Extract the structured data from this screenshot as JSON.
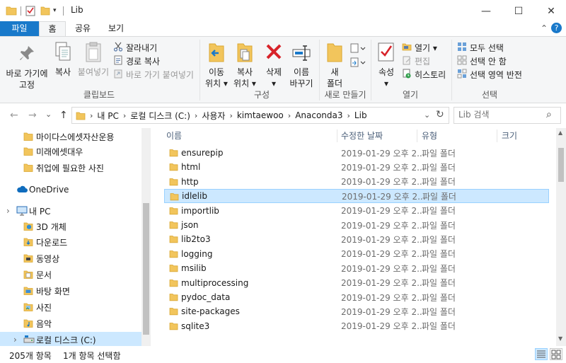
{
  "window": {
    "title": "Lib",
    "controls": {
      "minimize": "—",
      "maximize": "☐",
      "close": "✕"
    }
  },
  "ribbon_tabs": [
    "파일",
    "홈",
    "공유",
    "보기"
  ],
  "ribbon_tab_active": "홈",
  "ribbon_right": {
    "chevron": "⌃",
    "help": "?"
  },
  "ribbon": {
    "clipboard": {
      "pin": "바로 가기에\n고정",
      "copy": "복사",
      "paste": "붙여넣기",
      "cut": "잘라내기",
      "copy_path": "경로 복사",
      "paste_shortcut": "바로 가기 붙여넣기",
      "group_label": "클립보드"
    },
    "organize": {
      "move_to": "이동\n위치 ▾",
      "copy_to": "복사\n위치 ▾",
      "delete": "삭제\n▾",
      "rename": "이름\n바꾸기",
      "group_label": "구성"
    },
    "new": {
      "new_folder": "새\n폴더",
      "group_label": "새로 만들기"
    },
    "open": {
      "properties": "속성\n▾",
      "open": "열기 ▾",
      "edit": "편집",
      "history": "히스토리",
      "group_label": "열기"
    },
    "select": {
      "select_all": "모두 선택",
      "select_none": "선택 안 함",
      "invert": "선택 영역 반전",
      "group_label": "선택"
    }
  },
  "address": {
    "back": "←",
    "forward": "→",
    "recent": "⌄",
    "up": "↑",
    "crumbs": [
      "내 PC",
      "로컬 디스크 (C:)",
      "사용자",
      "kimtaewoo",
      "Anaconda3",
      "Lib"
    ],
    "dropdown": "⌄",
    "refresh": "↻",
    "search_placeholder": "Lib 검색",
    "search_icon": "⌕"
  },
  "nav_pane": {
    "items": [
      {
        "label": "마이다스에셋자산운용",
        "icon": "folder-icon"
      },
      {
        "label": "미래에셋대우",
        "icon": "folder-icon"
      },
      {
        "label": "취업에 필요한 사진",
        "icon": "folder-icon"
      },
      {
        "label": "OneDrive",
        "icon": "cloud-icon"
      },
      {
        "label": "내 PC",
        "icon": "pc-icon"
      },
      {
        "label": "3D 개체",
        "icon": "3d-objects-icon"
      },
      {
        "label": "다운로드",
        "icon": "download-icon"
      },
      {
        "label": "동영상",
        "icon": "video-icon"
      },
      {
        "label": "문서",
        "icon": "document-icon"
      },
      {
        "label": "바탕 화면",
        "icon": "desktop-icon"
      },
      {
        "label": "사진",
        "icon": "pictures-icon"
      },
      {
        "label": "음악",
        "icon": "music-icon"
      },
      {
        "label": "로컬 디스크 (C:)",
        "icon": "drive-icon"
      }
    ],
    "selected": "로컬 디스크 (C:)",
    "expander": "›"
  },
  "file_list": {
    "sort_indicator": "^",
    "columns": [
      "이름",
      "수정한 날짜",
      "유형",
      "크기"
    ],
    "rows": [
      {
        "name": "ensurepip",
        "date": "2019-01-29 오후 2...",
        "type": "파일 폴더"
      },
      {
        "name": "html",
        "date": "2019-01-29 오후 2...",
        "type": "파일 폴더"
      },
      {
        "name": "http",
        "date": "2019-01-29 오후 2...",
        "type": "파일 폴더"
      },
      {
        "name": "idlelib",
        "date": "2019-01-29 오후 2...",
        "type": "파일 폴더"
      },
      {
        "name": "importlib",
        "date": "2019-01-29 오후 2...",
        "type": "파일 폴더"
      },
      {
        "name": "json",
        "date": "2019-01-29 오후 2...",
        "type": "파일 폴더"
      },
      {
        "name": "lib2to3",
        "date": "2019-01-29 오후 2...",
        "type": "파일 폴더"
      },
      {
        "name": "logging",
        "date": "2019-01-29 오후 2...",
        "type": "파일 폴더"
      },
      {
        "name": "msilib",
        "date": "2019-01-29 오후 2...",
        "type": "파일 폴더"
      },
      {
        "name": "multiprocessing",
        "date": "2019-01-29 오후 2...",
        "type": "파일 폴더"
      },
      {
        "name": "pydoc_data",
        "date": "2019-01-29 오후 2...",
        "type": "파일 폴더"
      },
      {
        "name": "site-packages",
        "date": "2019-01-29 오후 2...",
        "type": "파일 폴더"
      },
      {
        "name": "sqlite3",
        "date": "2019-01-29 오후 2...",
        "type": "파일 폴더"
      }
    ],
    "selected": "idlelib"
  },
  "status": {
    "item_count": "205개 항목",
    "selection": "1개 항목 선택함"
  },
  "colors": {
    "accent": "#1979ca",
    "selection": "#cce8ff",
    "selection_border": "#99d1ff",
    "folder": "#f2c55c",
    "delete_red": "#d8232a"
  }
}
